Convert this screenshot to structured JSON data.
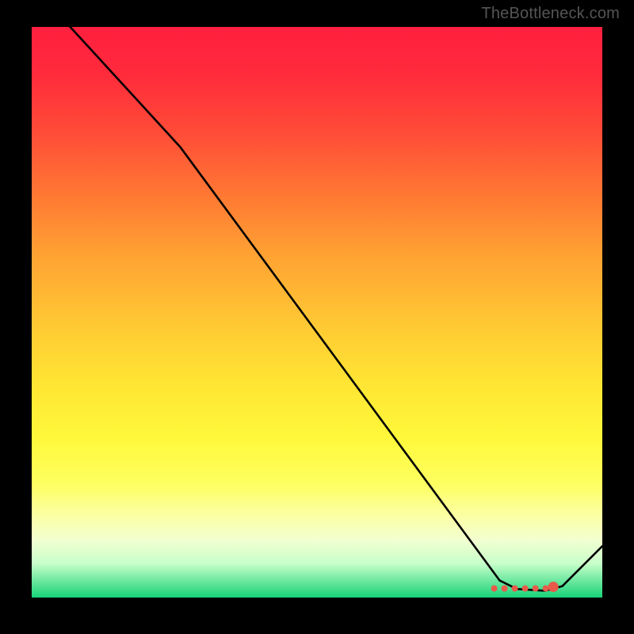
{
  "watermark": "TheBottleneck.com",
  "chart_data": {
    "type": "line",
    "title": "",
    "xlabel": "",
    "ylabel": "",
    "xlim": [
      0,
      100
    ],
    "ylim": [
      0,
      100
    ],
    "series": [
      {
        "name": "curve",
        "points": [
          {
            "x": 4,
            "y": 103
          },
          {
            "x": 26,
            "y": 79
          },
          {
            "x": 82,
            "y": 3
          },
          {
            "x": 85,
            "y": 1.5
          },
          {
            "x": 90,
            "y": 1.2
          },
          {
            "x": 93,
            "y": 2
          },
          {
            "x": 100,
            "y": 9
          }
        ]
      },
      {
        "name": "marker-band",
        "xrange": [
          80.5,
          91
        ],
        "y": 1.6
      }
    ],
    "gradient_stops": [
      {
        "pos": 0,
        "color": "#ff203f"
      },
      {
        "pos": 80,
        "color": "#feff60"
      },
      {
        "pos": 100,
        "color": "#18d47a"
      }
    ]
  }
}
